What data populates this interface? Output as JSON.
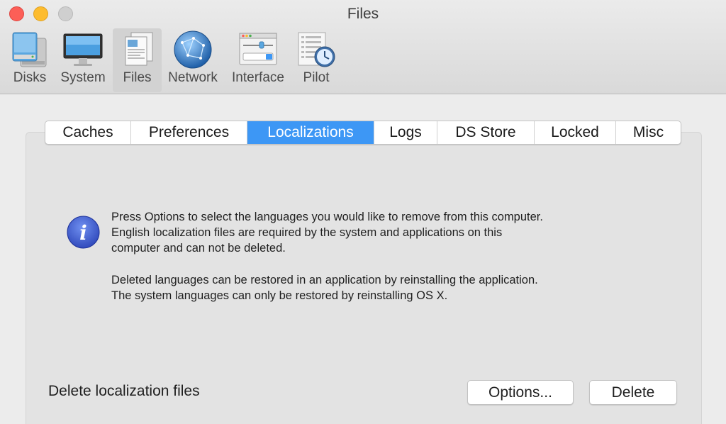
{
  "window": {
    "title": "Files"
  },
  "toolbar": {
    "items": [
      {
        "label": "Disks",
        "icon": "disks-icon"
      },
      {
        "label": "System",
        "icon": "monitor-icon"
      },
      {
        "label": "Files",
        "icon": "files-icon",
        "selected": true
      },
      {
        "label": "Network",
        "icon": "globe-icon"
      },
      {
        "label": "Interface",
        "icon": "interface-icon"
      },
      {
        "label": "Pilot",
        "icon": "pilot-icon"
      }
    ]
  },
  "tabs": {
    "items": [
      {
        "label": "Caches"
      },
      {
        "label": "Preferences"
      },
      {
        "label": "Localizations",
        "active": true
      },
      {
        "label": "Logs"
      },
      {
        "label": "DS Store"
      },
      {
        "label": "Locked"
      },
      {
        "label": "Misc"
      }
    ]
  },
  "message": {
    "icon": "info-icon",
    "lines": [
      "Press Options to select the languages you would like to remove from this computer.",
      "English localization files are required by the system and applications on this",
      "computer and can not be deleted.",
      "Deleted languages can be restored in an application by reinstalling the application.",
      "The system languages can only be restored by reinstalling OS X."
    ]
  },
  "footer": {
    "label": "Delete localization files",
    "options_label": "Options...",
    "delete_label": "Delete"
  },
  "colors": {
    "accent": "#3d97f5",
    "close": "#fc5f57",
    "minimize": "#fdbc2e",
    "zoom": "#cfcfcf"
  }
}
